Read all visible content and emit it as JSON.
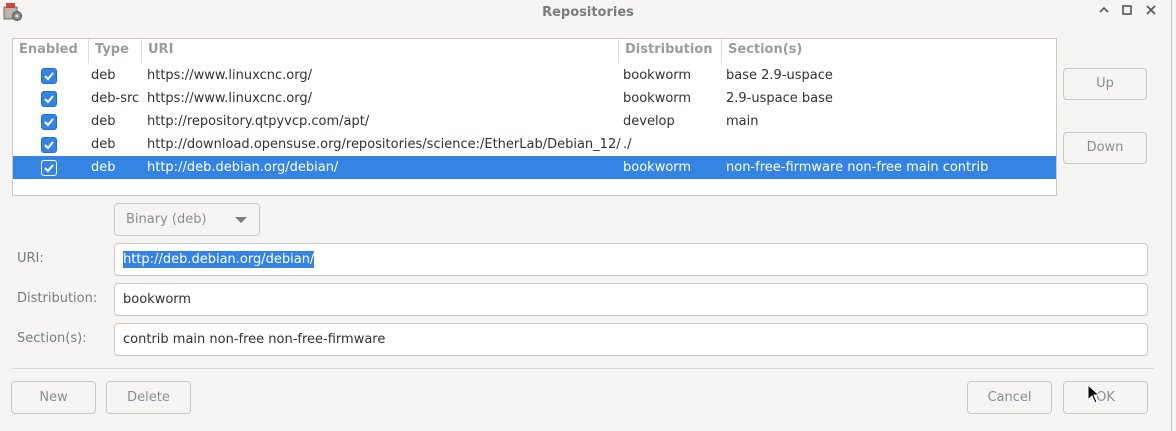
{
  "window": {
    "title": "Repositories"
  },
  "table": {
    "headers": [
      "Enabled",
      "Type",
      "URI",
      "Distribution",
      "Section(s)"
    ],
    "rows": [
      {
        "enabled": true,
        "type": "deb",
        "uri": "https://www.linuxcnc.org/",
        "distribution": "bookworm",
        "sections": "base 2.9-uspace",
        "selected": false
      },
      {
        "enabled": true,
        "type": "deb-src",
        "uri": "https://www.linuxcnc.org/",
        "distribution": "bookworm",
        "sections": "2.9-uspace base",
        "selected": false
      },
      {
        "enabled": true,
        "type": "deb",
        "uri": "http://repository.qtpyvcp.com/apt/",
        "distribution": "develop",
        "sections": "main",
        "selected": false
      },
      {
        "enabled": true,
        "type": "deb",
        "uri": "http://download.opensuse.org/repositories/science:/EtherLab/Debian_12/",
        "distribution": "./",
        "sections": "",
        "selected": false
      },
      {
        "enabled": true,
        "type": "deb",
        "uri": "http://deb.debian.org/debian/",
        "distribution": "bookworm",
        "sections": "non-free-firmware non-free main contrib",
        "selected": true
      }
    ]
  },
  "side_buttons": {
    "up": "Up",
    "down": "Down"
  },
  "editor": {
    "type_value": "Binary (deb)",
    "uri_label": "URI:",
    "uri_value": "http://deb.debian.org/debian/",
    "distribution_label": "Distribution:",
    "distribution_value": "bookworm",
    "sections_label": "Section(s):",
    "sections_value": "contrib main non-free non-free-firmware"
  },
  "footer": {
    "new": "New",
    "delete": "Delete",
    "cancel": "Cancel",
    "ok": "OK"
  },
  "colors": {
    "accent": "#3584e4",
    "background": "#f6f5f4"
  }
}
